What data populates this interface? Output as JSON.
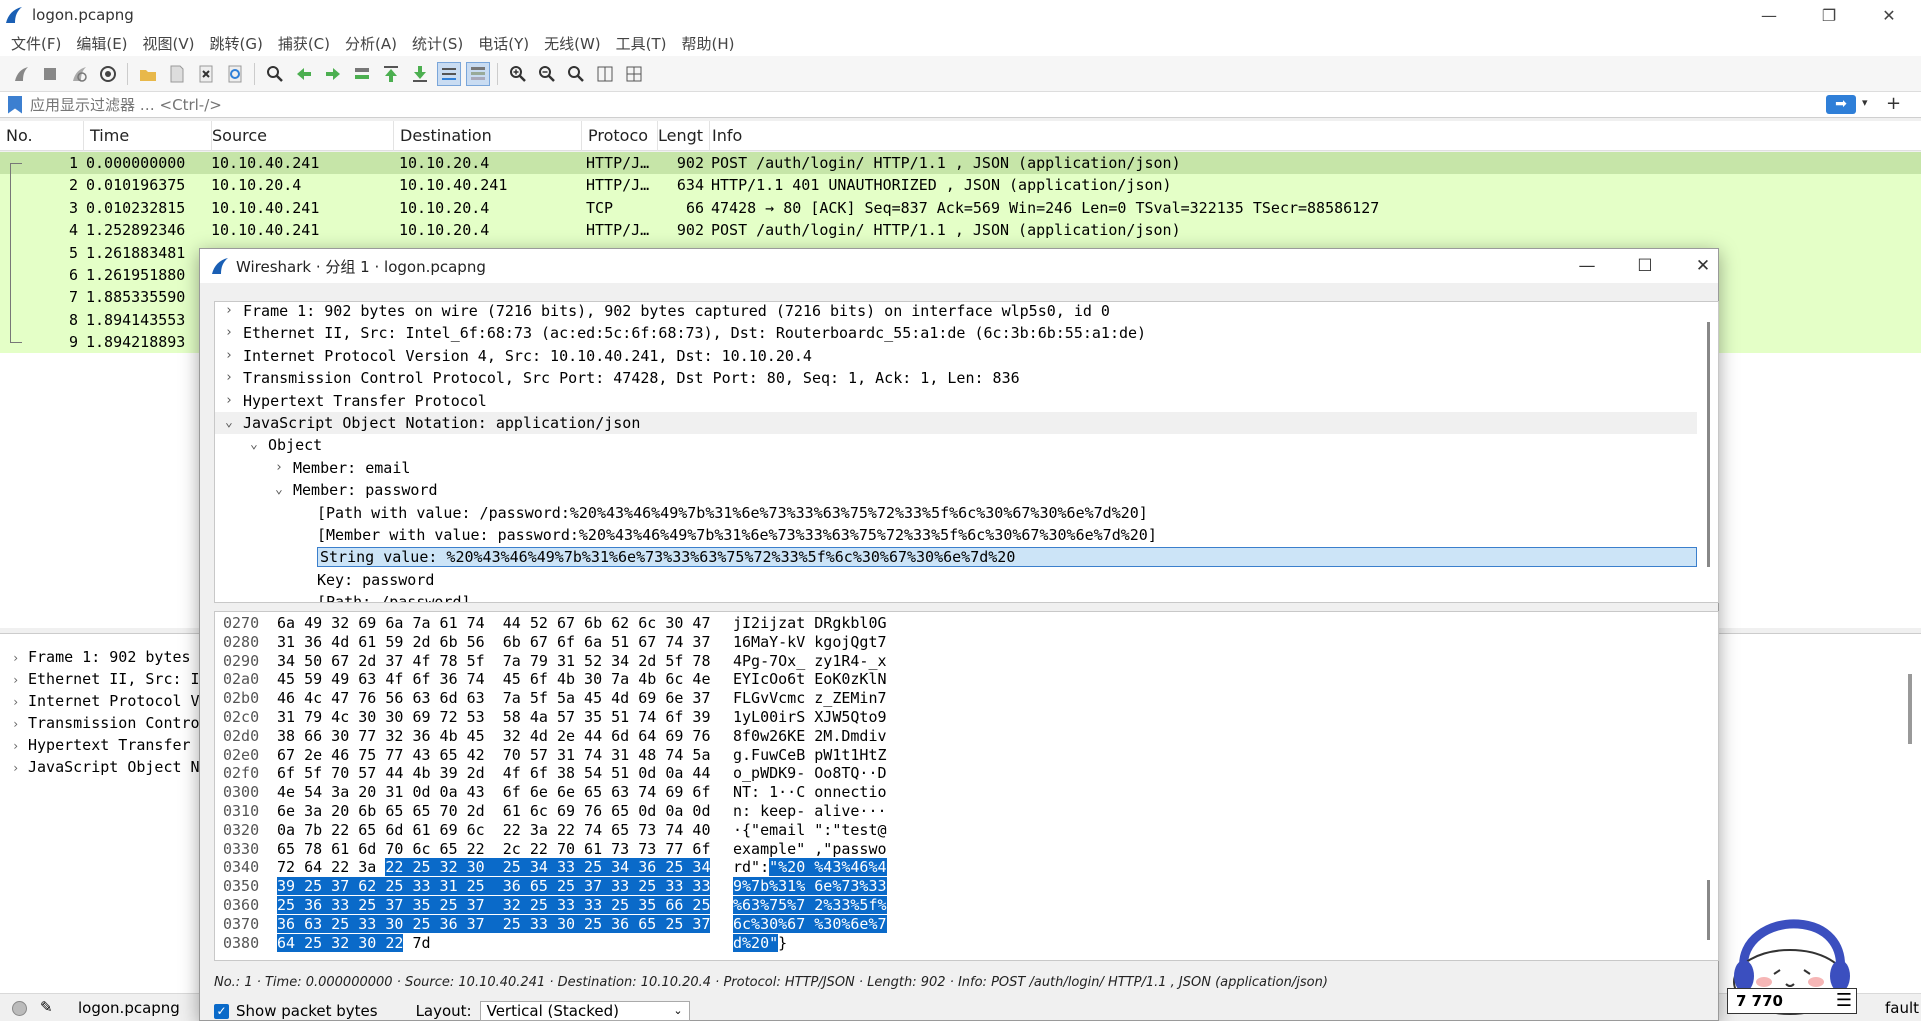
{
  "window": {
    "title": "logon.pcapng"
  },
  "menu": [
    "文件(F)",
    "编辑(E)",
    "视图(V)",
    "跳转(G)",
    "捕获(C)",
    "分析(A)",
    "统计(S)",
    "电话(Y)",
    "无线(W)",
    "工具(T)",
    "帮助(H)"
  ],
  "toolbar": {
    "buttons": [
      "start-capture-icon",
      "stop-capture-icon",
      "restart-capture-icon",
      "capture-options-icon",
      "open-file-icon",
      "save-file-icon",
      "close-file-icon",
      "reload-icon",
      "find-packet-icon",
      "go-back-icon",
      "go-forward-icon",
      "go-to-packet-icon",
      "first-packet-icon",
      "last-packet-icon",
      "autoscroll-icon",
      "colorize-icon",
      "zoom-in-icon",
      "zoom-out-icon",
      "zoom-reset-icon",
      "resize-columns-icon",
      "layout-icon"
    ]
  },
  "filter": {
    "placeholder": "应用显示过滤器 … <Ctrl-/>",
    "apply_glyph": "➡",
    "dropdown_glyph": "▾",
    "add_glyph": "+"
  },
  "packet_list": {
    "columns": [
      "No.",
      "Time",
      "Source",
      "Destination",
      "Protoco",
      "Lengt",
      "Info"
    ],
    "rows": [
      {
        "no": "1",
        "time": "0.000000000",
        "src": "10.10.40.241",
        "dst": "10.10.20.4",
        "proto": "HTTP/J…",
        "len": "902",
        "info": "POST /auth/login/ HTTP/1.1 , JSON (application/json)"
      },
      {
        "no": "2",
        "time": "0.010196375",
        "src": "10.10.20.4",
        "dst": "10.10.40.241",
        "proto": "HTTP/J…",
        "len": "634",
        "info": "HTTP/1.1 401 UNAUTHORIZED , JSON (application/json)"
      },
      {
        "no": "3",
        "time": "0.010232815",
        "src": "10.10.40.241",
        "dst": "10.10.20.4",
        "proto": "TCP",
        "len": "66",
        "info": "47428 → 80 [ACK] Seq=837 Ack=569 Win=246 Len=0 TSval=322135 TSecr=88586127"
      },
      {
        "no": "4",
        "time": "1.252892346",
        "src": "10.10.40.241",
        "dst": "10.10.20.4",
        "proto": "HTTP/J…",
        "len": "902",
        "info": "POST /auth/login/ HTTP/1.1 , JSON (application/json)"
      },
      {
        "no": "5",
        "time": "1.261883481",
        "src": "",
        "dst": "",
        "proto": "",
        "len": "",
        "info": ""
      },
      {
        "no": "6",
        "time": "1.261951880",
        "src": "",
        "dst": "",
        "proto": "",
        "len": "",
        "info": ""
      },
      {
        "no": "7",
        "time": "1.885335590",
        "src": "",
        "dst": "",
        "proto": "",
        "len": "",
        "info": ""
      },
      {
        "no": "8",
        "time": "1.894143553",
        "src": "",
        "dst": "",
        "proto": "",
        "len": "",
        "info": ""
      },
      {
        "no": "9",
        "time": "1.894218893",
        "src": "",
        "dst": "",
        "proto": "",
        "len": "",
        "info": ""
      }
    ]
  },
  "detail_pane": {
    "items": [
      "Frame 1: 902 bytes",
      "Ethernet II, Src: I",
      "Internet Protocol V",
      "Transmission Contro",
      "Hypertext Transfer",
      "JavaScript Object N"
    ]
  },
  "status": {
    "file": "logon.pcapng",
    "profile_tail": "fault"
  },
  "dialog": {
    "title": "Wireshark · 分组 1 · logon.pcapng",
    "tree": [
      {
        "arrow": "›",
        "text": "Frame 1: 902 bytes on wire (7216 bits), 902 bytes captured (7216 bits) on interface wlp5s0, id 0"
      },
      {
        "arrow": "›",
        "text": "Ethernet II, Src: Intel_6f:68:73 (ac:ed:5c:6f:68:73), Dst: Routerboardc_55:a1:de (6c:3b:6b:55:a1:de)"
      },
      {
        "arrow": "›",
        "text": "Internet Protocol Version 4, Src: 10.10.40.241, Dst: 10.10.20.4"
      },
      {
        "arrow": "›",
        "text": "Transmission Control Protocol, Src Port: 47428, Dst Port: 80, Seq: 1, Ack: 1, Len: 836"
      },
      {
        "arrow": "›",
        "text": "Hypertext Transfer Protocol"
      },
      {
        "arrow": "⌄",
        "text": "JavaScript Object Notation: application/json"
      },
      {
        "arrow": "⌄",
        "text": "Object"
      },
      {
        "arrow": "›",
        "text": "Member: email"
      },
      {
        "arrow": "⌄",
        "text": "Member: password"
      },
      {
        "arrow": "",
        "text": "[Path with value: /password:%20%43%46%49%7b%31%6e%73%33%63%75%72%33%5f%6c%30%67%30%6e%7d%20]"
      },
      {
        "arrow": "",
        "text": "[Member with value: password:%20%43%46%49%7b%31%6e%73%33%63%75%72%33%5f%6c%30%67%30%6e%7d%20]"
      },
      {
        "arrow": "",
        "text": "String value: %20%43%46%49%7b%31%6e%73%33%63%75%72%33%5f%6c%30%67%30%6e%7d%20"
      },
      {
        "arrow": "",
        "text": "Key: password"
      },
      {
        "arrow": "",
        "text": "[Path: /password]"
      }
    ],
    "hex": [
      {
        "off": "0270",
        "pre": "6a 49 32 69 6a 7a 61 74  44 52 67 6b 62 6c 30 47",
        "sel": "",
        "post": "",
        "apre": "jI2ijzat DRgkbl0G",
        "asel": "",
        "apost": ""
      },
      {
        "off": "0280",
        "pre": "31 36 4d 61 59 2d 6b 56  6b 67 6f 6a 51 67 74 37",
        "sel": "",
        "post": "",
        "apre": "16MaY-kV kgojQgt7",
        "asel": "",
        "apost": ""
      },
      {
        "off": "0290",
        "pre": "34 50 67 2d 37 4f 78 5f  7a 79 31 52 34 2d 5f 78",
        "sel": "",
        "post": "",
        "apre": "4Pg-7Ox_ zy1R4-_x",
        "asel": "",
        "apost": ""
      },
      {
        "off": "02a0",
        "pre": "45 59 49 63 4f 6f 36 74  45 6f 4b 30 7a 4b 6c 4e",
        "sel": "",
        "post": "",
        "apre": "EYIcOo6t EoK0zKlN",
        "asel": "",
        "apost": ""
      },
      {
        "off": "02b0",
        "pre": "46 4c 47 76 56 63 6d 63  7a 5f 5a 45 4d 69 6e 37",
        "sel": "",
        "post": "",
        "apre": "FLGvVcmc z_ZEMin7",
        "asel": "",
        "apost": ""
      },
      {
        "off": "02c0",
        "pre": "31 79 4c 30 30 69 72 53  58 4a 57 35 51 74 6f 39",
        "sel": "",
        "post": "",
        "apre": "1yL00irS XJW5Qto9",
        "asel": "",
        "apost": ""
      },
      {
        "off": "02d0",
        "pre": "38 66 30 77 32 36 4b 45  32 4d 2e 44 6d 64 69 76",
        "sel": "",
        "post": "",
        "apre": "8f0w26KE 2M.Dmdiv",
        "asel": "",
        "apost": ""
      },
      {
        "off": "02e0",
        "pre": "67 2e 46 75 77 43 65 42  70 57 31 74 31 48 74 5a",
        "sel": "",
        "post": "",
        "apre": "g.FuwCeB pW1t1HtZ",
        "asel": "",
        "apost": ""
      },
      {
        "off": "02f0",
        "pre": "6f 5f 70 57 44 4b 39 2d  4f 6f 38 54 51 0d 0a 44",
        "sel": "",
        "post": "",
        "apre": "o_pWDK9- Oo8TQ··D",
        "asel": "",
        "apost": ""
      },
      {
        "off": "0300",
        "pre": "4e 54 3a 20 31 0d 0a 43  6f 6e 6e 65 63 74 69 6f",
        "sel": "",
        "post": "",
        "apre": "NT: 1··C onnectio",
        "asel": "",
        "apost": ""
      },
      {
        "off": "0310",
        "pre": "6e 3a 20 6b 65 65 70 2d  61 6c 69 76 65 0d 0a 0d",
        "sel": "",
        "post": "",
        "apre": "n: keep- alive···",
        "asel": "",
        "apost": ""
      },
      {
        "off": "0320",
        "pre": "0a 7b 22 65 6d 61 69 6c  22 3a 22 74 65 73 74 40",
        "sel": "",
        "post": "",
        "apre": "·{\"email \":\"test@",
        "asel": "",
        "apost": ""
      },
      {
        "off": "0330",
        "pre": "65 78 61 6d 70 6c 65 22  2c 22 70 61 73 73 77 6f",
        "sel": "",
        "post": "",
        "apre": "example\" ,\"passwo",
        "asel": "",
        "apost": ""
      },
      {
        "off": "0340",
        "pre": "72 64 22 3a ",
        "sel": "22 25 32 30  25 34 33 25 34 36 25 34",
        "post": "",
        "apre": "rd\":",
        "asel": "\"%20 %43%46%4",
        "apost": ""
      },
      {
        "off": "0350",
        "pre": "",
        "sel": "39 25 37 62 25 33 31 25  36 65 25 37 33 25 33 33",
        "post": "",
        "apre": "",
        "asel": "9%7b%31% 6e%73%33",
        "apost": ""
      },
      {
        "off": "0360",
        "pre": "",
        "sel": "25 36 33 25 37 35 25 37  32 25 33 33 25 35 66 25",
        "post": "",
        "apre": "",
        "asel": "%63%75%7 2%33%5f%",
        "apost": ""
      },
      {
        "off": "0370",
        "pre": "",
        "sel": "36 63 25 33 30 25 36 37  25 33 30 25 36 65 25 37",
        "post": "",
        "apre": "",
        "asel": "6c%30%67 %30%6e%7",
        "apost": ""
      },
      {
        "off": "0380",
        "pre": "",
        "sel": "64 25 32 30 22",
        "post": " 7d",
        "apre": "",
        "asel": "d%20\"",
        "apost": "}"
      }
    ],
    "info": "No.: 1 · Time: 0.000000000 · Source: 10.10.40.241 · Destination: 10.10.20.4 · Protocol: HTTP/JSON · Length: 902 · Info: POST /auth/login/ HTTP/1.1 , JSON (application/json)",
    "show_bytes_label": "Show packet bytes",
    "layout_label": "Layout:",
    "layout_value": "Vertical (Stacked)"
  },
  "overlay": {
    "counter": "7 770"
  },
  "colors": {
    "row_bg": "#e4ffc7",
    "row_selected": "#c6e5a8",
    "accent": "#0a6ac9"
  }
}
